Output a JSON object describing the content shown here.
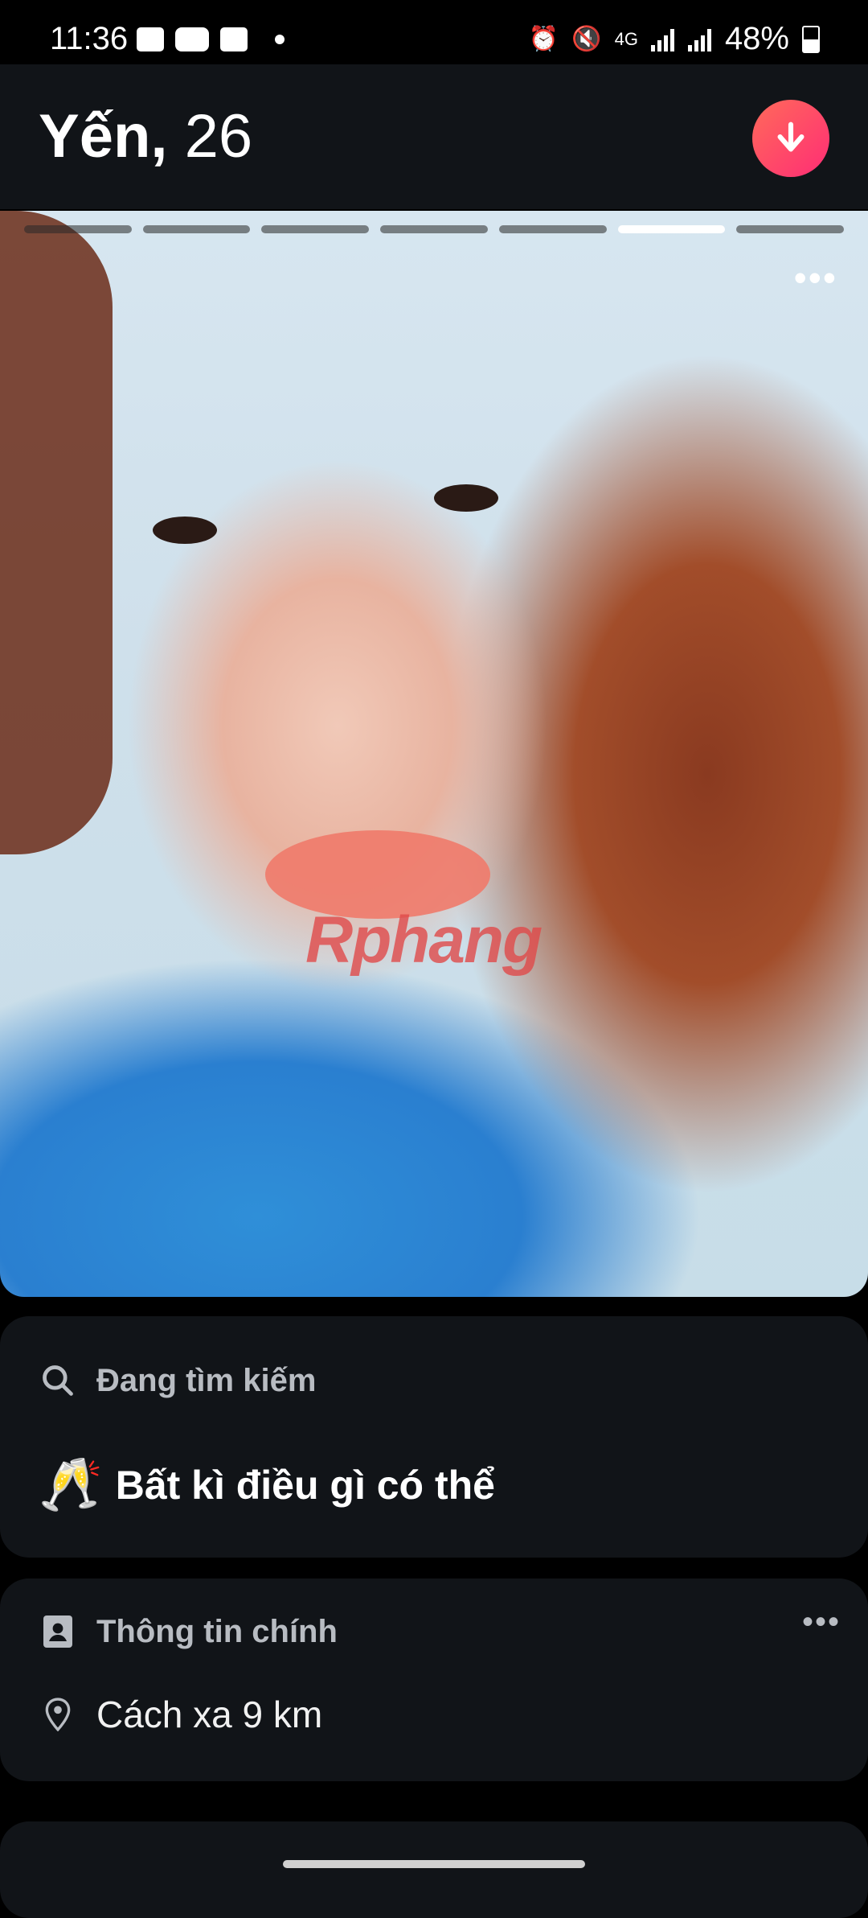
{
  "status_bar": {
    "time": "11:36",
    "network": "4G",
    "battery": "48%"
  },
  "profile": {
    "name": "Yến,",
    "age": "26"
  },
  "photo": {
    "progress_total": 7,
    "progress_active_index": 5,
    "watermark": "Rphang"
  },
  "looking_for": {
    "label": "Đang tìm kiếm",
    "emoji": "🥂",
    "value": "Bất kì điều gì có thể"
  },
  "basics": {
    "label": "Thông tin chính",
    "distance": "Cách xa 9 km"
  },
  "icons": {
    "search": "search-icon",
    "badge": "id-badge-icon",
    "location": "location-pin-icon",
    "down": "arrow-down-icon",
    "more": "more-dots-icon"
  },
  "colors": {
    "accent_start": "#ff6a5a",
    "accent_end": "#ff2d75",
    "card_bg": "#111418"
  }
}
